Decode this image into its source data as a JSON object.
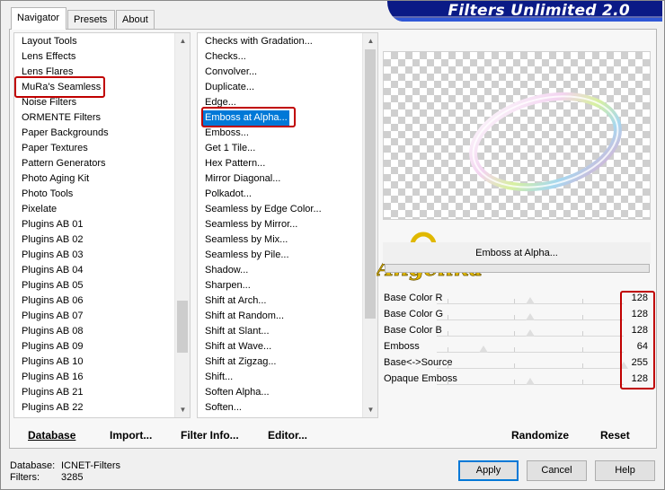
{
  "window": {
    "banner_title": "Filters Unlimited 2.0",
    "colors": {
      "banner": "#0a1a86",
      "selection": "#0078d7",
      "highlight_box": "#c00000"
    }
  },
  "tabs": [
    {
      "label": "Navigator",
      "active": true
    },
    {
      "label": "Presets",
      "active": false
    },
    {
      "label": "About",
      "active": false
    }
  ],
  "categories": {
    "items": [
      "Layout Tools",
      "Lens Effects",
      "Lens Flares",
      "MuRa's Seamless",
      "Noise Filters",
      "ORMENTE Filters",
      "Paper Backgrounds",
      "Paper Textures",
      "Pattern Generators",
      "Photo Aging Kit",
      "Photo Tools",
      "Pixelate",
      "Plugins AB 01",
      "Plugins AB 02",
      "Plugins AB 03",
      "Plugins AB 04",
      "Plugins AB 05",
      "Plugins AB 06",
      "Plugins AB 07",
      "Plugins AB 08",
      "Plugins AB 09",
      "Plugins AB 10",
      "Plugins AB 16",
      "Plugins AB 21",
      "Plugins AB 22"
    ],
    "selected": "MuRa's Seamless"
  },
  "filters": {
    "items": [
      "Checks with Gradation...",
      "Checks...",
      "Convolver...",
      "Duplicate...",
      "Edge...",
      "Emboss at Alpha...",
      "Emboss...",
      "Get 1 Tile...",
      "Hex Pattern...",
      "Mirror Diagonal...",
      "Polkadot...",
      "Seamless by Edge Color...",
      "Seamless by Mirror...",
      "Seamless by Mix...",
      "Seamless by Pile...",
      "Shadow...",
      "Sharpen...",
      "Shift at Arch...",
      "Shift at Random...",
      "Shift at Slant...",
      "Shift at Wave...",
      "Shift at Zigzag...",
      "Shift...",
      "Soften Alpha...",
      "Soften..."
    ],
    "selected": "Emboss at Alpha..."
  },
  "preview": {
    "filter_name": "Emboss at Alpha...",
    "watermark": "Angelika"
  },
  "params": [
    {
      "label": "Base Color R",
      "value": "128",
      "level": 0.5
    },
    {
      "label": "Base Color G",
      "value": "128",
      "level": 0.5
    },
    {
      "label": "Base Color B",
      "value": "128",
      "level": 0.5
    },
    {
      "label": "Emboss",
      "value": "64",
      "level": 0.25
    },
    {
      "label": "Base<->Source",
      "value": "255",
      "level": 1.0
    },
    {
      "label": "Opaque Emboss",
      "value": "128",
      "level": 0.5
    }
  ],
  "toolbar": {
    "database": "Database",
    "import": "Import...",
    "filter_info": "Filter Info...",
    "editor": "Editor...",
    "randomize": "Randomize",
    "reset": "Reset"
  },
  "status": {
    "database_label": "Database:",
    "database_value": "ICNET-Filters",
    "filters_label": "Filters:",
    "filters_value": "3285"
  },
  "buttons": {
    "apply": "Apply",
    "cancel": "Cancel",
    "help": "Help"
  }
}
